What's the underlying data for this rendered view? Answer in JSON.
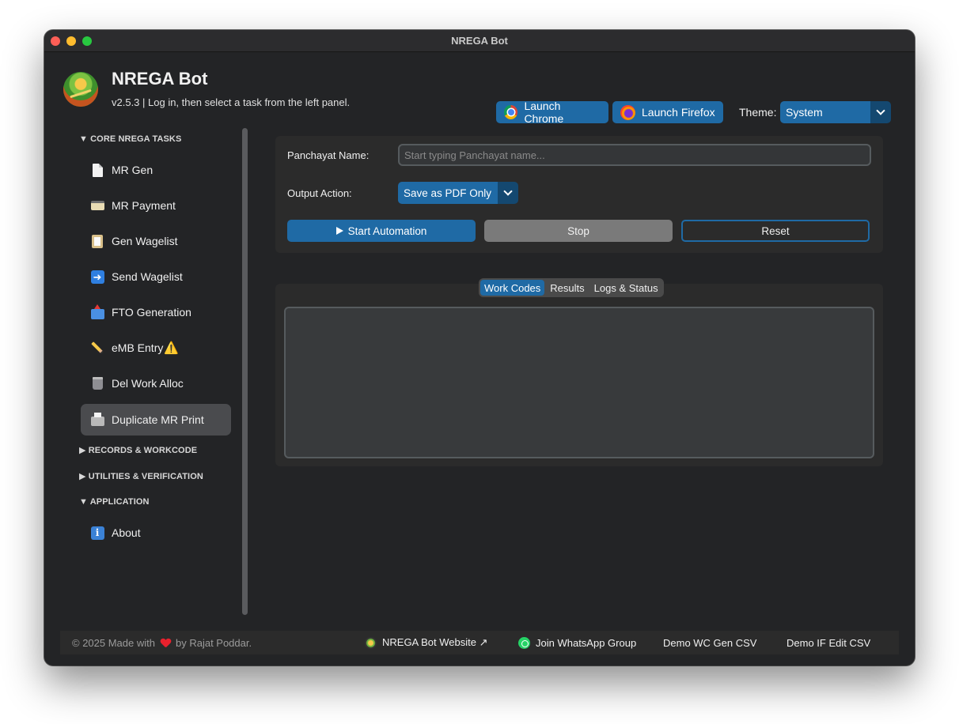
{
  "window": {
    "title": "NREGA Bot"
  },
  "header": {
    "app_name": "NREGA Bot",
    "subtitle": "v2.5.3 | Log in, then select a task from the left panel.",
    "launch_chrome": "Launch Chrome",
    "launch_firefox": "Launch Firefox",
    "theme_label": "Theme:",
    "theme_value": "System"
  },
  "sidebar": {
    "sections": [
      {
        "label": "▼ CORE NREGA TASKS"
      },
      {
        "label": "▶ RECORDS & WORKCODE"
      },
      {
        "label": "▶ UTILITIES & VERIFICATION"
      },
      {
        "label": "▼ APPLICATION"
      }
    ],
    "items": [
      {
        "label": "MR Gen",
        "icon": "document-icon"
      },
      {
        "label": "MR Payment",
        "icon": "credit-card-icon"
      },
      {
        "label": "Gen Wagelist",
        "icon": "clipboard-icon"
      },
      {
        "label": "Send Wagelist",
        "icon": "arrow-right-icon"
      },
      {
        "label": "FTO Generation",
        "icon": "outbox-tray-icon"
      },
      {
        "label": "eMB Entry",
        "icon": "pencil-icon",
        "badge": "⚠️"
      },
      {
        "label": "Del Work Alloc",
        "icon": "trash-icon"
      },
      {
        "label": "Duplicate MR Print",
        "icon": "printer-icon",
        "active": true
      },
      {
        "label": "About",
        "icon": "info-icon"
      }
    ]
  },
  "form": {
    "panchayat_label": "Panchayat Name:",
    "panchayat_placeholder": "Start typing Panchayat name...",
    "panchayat_value": "",
    "output_label": "Output Action:",
    "output_value": "Save as PDF Only",
    "start_label": "Start Automation",
    "stop_label": "Stop",
    "reset_label": "Reset"
  },
  "tabs": {
    "items": [
      "Work Codes",
      "Results",
      "Logs & Status"
    ],
    "active": "Work Codes"
  },
  "footer": {
    "copyright_prefix": "© 2025 Made with",
    "copyright_suffix": "by Rajat Poddar.",
    "website_link": "NREGA Bot Website ↗",
    "whatsapp_link": "Join WhatsApp Group",
    "demo_wc": "Demo WC Gen CSV",
    "demo_if": "Demo IF Edit CSV"
  },
  "colors": {
    "accent": "#1f6aa5",
    "accent_dark": "#144870",
    "background": "#232426",
    "card": "#2b2b2b"
  }
}
